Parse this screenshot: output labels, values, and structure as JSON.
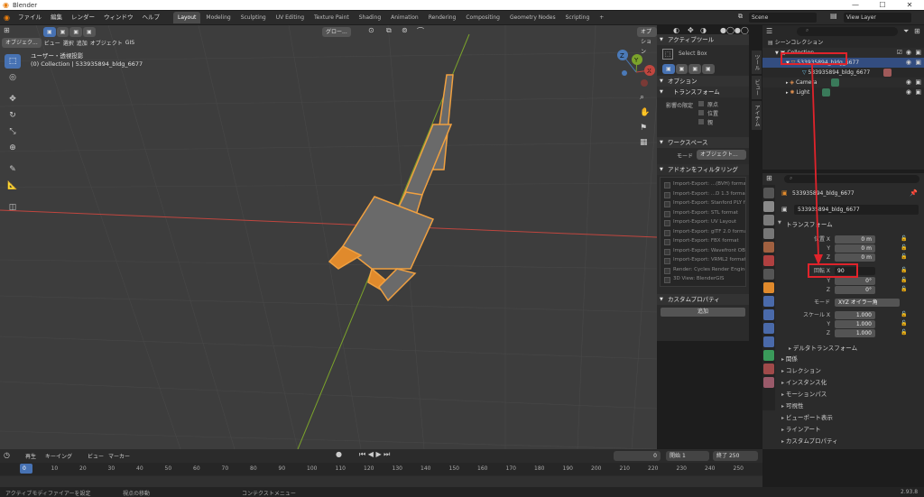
{
  "window": {
    "title": "Blender",
    "minimize": "—",
    "maximize": "☐",
    "close": "✕"
  },
  "menu": {
    "items": [
      "ファイル",
      "編集",
      "レンダー",
      "ウィンドウ",
      "ヘルプ"
    ],
    "workspaces": [
      "Layout",
      "Modeling",
      "Sculpting",
      "UV Editing",
      "Texture Paint",
      "Shading",
      "Animation",
      "Rendering",
      "Compositing",
      "Geometry Nodes",
      "Scripting"
    ],
    "active_workspace": "Layout",
    "add_tab": "+",
    "scene_label": "Scene",
    "view_layer_label": "View Layer"
  },
  "viewport": {
    "header": {
      "mode": "オブジェク...",
      "menus": [
        "ビュー",
        "選択",
        "追加",
        "オブジェクト",
        "GIS"
      ],
      "orientation": "グロー...",
      "options": "オプション"
    },
    "overlay_line1": "ユーザー・透視投影",
    "overlay_line2": "(0) Collection | 533935894_bldg_6677",
    "axis_labels": {
      "x": "X",
      "y": "Y",
      "z": "Z"
    }
  },
  "npanel": {
    "tabs": [
      "ツール",
      "ビュー",
      "アイテム"
    ],
    "active_tool_header": "アクティブツール",
    "active_tool": "Select Box",
    "options_header": "オプション",
    "transform_header": "トランスフォーム",
    "affect_only": "影響の限定",
    "checks": [
      "原点",
      "位置",
      "親"
    ],
    "workspace_header": "ワークスペース",
    "mode_label": "モード",
    "mode_value": "オブジェクト...",
    "filter_addons": "アドオンをフィルタリング",
    "addons": [
      "Import-Export: ...(BVH) format",
      "Import-Export: ...D 1.3 format",
      "Import-Export: Stanford PLY f...",
      "Import-Export: STL format",
      "Import-Export: UV Layout",
      "Import-Export: glTF 2.0 format",
      "Import-Export: FBX format",
      "Import-Export: Wavefront OB...",
      "Import-Export: VRML2 format",
      "Render: Cycles Render Engine",
      "3D View: BlenderGIS"
    ],
    "custom_props_header": "カスタムプロパティ",
    "new_button": "追加"
  },
  "outliner": {
    "search_placeholder": "",
    "rows": [
      {
        "label": "シーンコレクション",
        "indent": 0
      },
      {
        "label": "Collection",
        "indent": 1
      },
      {
        "label": "533935894_bldg_6677",
        "indent": 2
      },
      {
        "label": "533935894_bldg_6677",
        "indent": 3
      },
      {
        "label": "Camera",
        "indent": 2
      },
      {
        "label": "Light",
        "indent": 2
      }
    ]
  },
  "properties": {
    "object_name": "533935894_bldg_6677",
    "mesh_name": "533935894_bldg_6677",
    "transform_header": "トランスフォーム",
    "location": {
      "label": "位置 X",
      "x": "0 m",
      "y": "0 m",
      "z": "0 m",
      "y_label": "Y",
      "z_label": "Z"
    },
    "rotation": {
      "label": "回転 X",
      "x": "90",
      "y": "0°",
      "z": "0°",
      "y_label": "Y",
      "z_label": "Z"
    },
    "mode": {
      "label": "モード",
      "value": "XYZ オイラー角"
    },
    "scale": {
      "label": "スケール X",
      "x": "1.000",
      "y": "1.000",
      "z": "1.000",
      "y_label": "Y",
      "z_label": "Z"
    },
    "delta_transform": "デルタトランスフォーム",
    "sections": [
      "関係",
      "コレクション",
      "インスタンス化",
      "モーションパス",
      "可視性",
      "ビューポート表示",
      "ラインアート",
      "カスタムプロパティ"
    ]
  },
  "timeline": {
    "menus": [
      "再生",
      "キーイング",
      "ビュー",
      "マーカー"
    ],
    "current_frame": "0",
    "start_label": "開始",
    "start": "1",
    "end_label": "終了",
    "end": "250",
    "ticks": [
      "0",
      "10",
      "20",
      "30",
      "40",
      "50",
      "60",
      "70",
      "80",
      "90",
      "100",
      "110",
      "120",
      "130",
      "140",
      "150",
      "160",
      "170",
      "180",
      "190",
      "200",
      "210",
      "220",
      "230",
      "240",
      "250"
    ]
  },
  "statusbar": {
    "left": "アクティブモディファイアーを設定",
    "mid": "視点の移動",
    "right": "コンテクストメニュー",
    "version": "2.93.8"
  },
  "colors": {
    "accent": "#4772b3",
    "selection_orange": "#f0a040",
    "annotation_red": "#e0232b",
    "x_axis": "#c0463f",
    "y_axis": "#7ba32b"
  }
}
